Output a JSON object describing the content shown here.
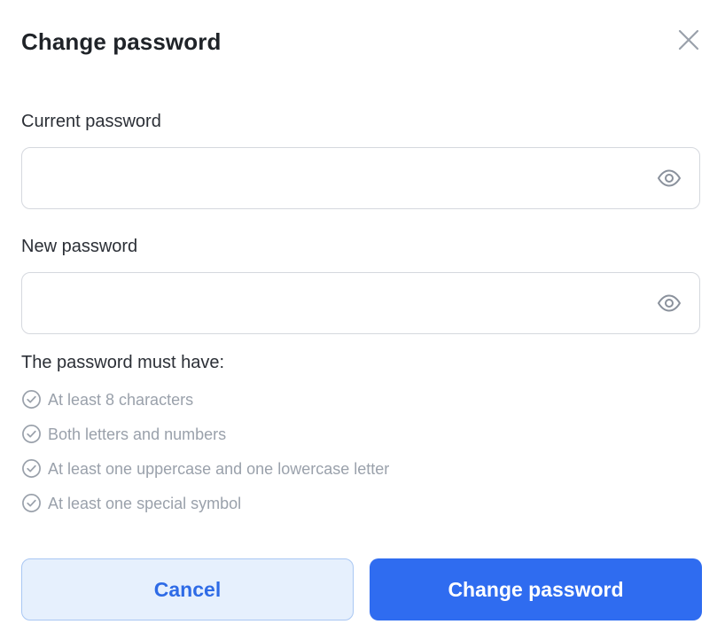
{
  "dialog": {
    "title": "Change password",
    "close_icon": "close-icon"
  },
  "fields": {
    "current": {
      "label": "Current password",
      "value": "",
      "placeholder": "",
      "toggle_icon": "eye-icon"
    },
    "new": {
      "label": "New password",
      "value": "",
      "placeholder": "",
      "toggle_icon": "eye-icon"
    }
  },
  "requirements": {
    "heading": "The password must have:",
    "icon": "check-circle-icon",
    "items": [
      "At least 8 characters",
      "Both letters and numbers",
      "At least one uppercase and one lowercase letter",
      "At least one special symbol"
    ]
  },
  "actions": {
    "cancel_label": "Cancel",
    "submit_label": "Change password"
  },
  "colors": {
    "primary": "#2f6cf0",
    "cancel_bg": "#e6f0fd",
    "muted": "#9aa1ab"
  }
}
